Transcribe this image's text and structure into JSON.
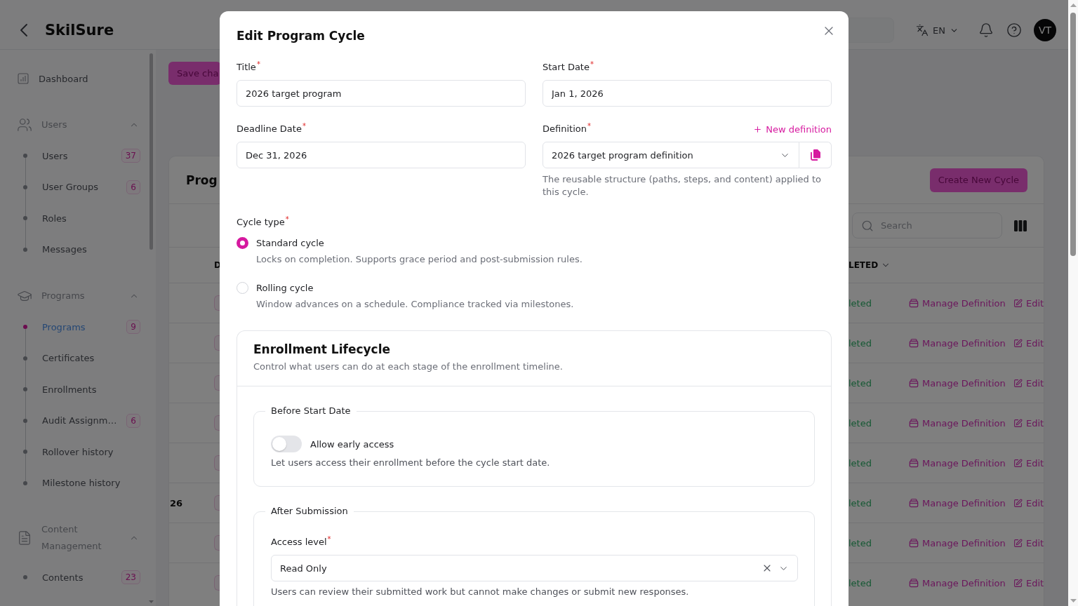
{
  "header": {
    "title": "SkilSure",
    "language": "EN",
    "avatar": "VT"
  },
  "sidebar": {
    "items": [
      {
        "kind": "link",
        "label": "Dashboard",
        "selected": false
      },
      {
        "kind": "group",
        "label": "Users",
        "expanded": true,
        "children": [
          {
            "label": "Users",
            "badge": "37",
            "selected": false
          },
          {
            "label": "User Groups",
            "badge": "6",
            "selected": false
          },
          {
            "label": "Roles",
            "selected": false
          },
          {
            "label": "Messages",
            "selected": false
          }
        ]
      },
      {
        "kind": "group",
        "label": "Programs",
        "expanded": true,
        "children": [
          {
            "label": "Programs",
            "badge": "9",
            "selected": true
          },
          {
            "label": "Certificates",
            "selected": false
          },
          {
            "label": "Enrollments",
            "selected": false
          },
          {
            "label": "Audit Assignm…",
            "badge": "6",
            "selected": false
          },
          {
            "label": "Rollover history",
            "selected": false
          },
          {
            "label": "Milestone history",
            "selected": false
          }
        ]
      },
      {
        "kind": "group",
        "label": "Content Management",
        "expanded": true,
        "children": [
          {
            "label": "Contents",
            "badge": "23",
            "selected": false
          }
        ]
      }
    ]
  },
  "main": {
    "save_button": "Save cha",
    "table_card": {
      "title": "Prog",
      "create_button": "Create New Cycle",
      "search": {
        "placeholder": "Search"
      },
      "columns": [
        "D",
        "LETED"
      ],
      "rows": [
        {
          "column_3": "leted",
          "actions": [
            "Manage Definition",
            "Edit"
          ]
        },
        {
          "column_3": "leted",
          "actions": [
            "Manage Definition",
            "Edit"
          ]
        },
        {
          "column_3": "leted",
          "actions": [
            "Manage Definition",
            "Edit"
          ]
        },
        {
          "column_3": "leted",
          "actions": [
            "Manage Definition",
            "Edit"
          ]
        },
        {
          "column_3": "leted",
          "actions": [
            "Manage Definition",
            "Edit"
          ]
        },
        {
          "column_1": "26",
          "column_3": "leted",
          "actions": [
            "Manage Definition",
            "Edit"
          ]
        },
        {
          "column_3": "leted",
          "actions": [
            "Manage Definition",
            "Edit"
          ]
        },
        {
          "column_3": "leted",
          "actions": [
            "Manage Definition",
            "Edit"
          ]
        }
      ]
    }
  },
  "dialog": {
    "title": "Edit Program Cycle",
    "fields": [
      {
        "kind": "text",
        "label": "Title$^{*}$",
        "value": "2026 target program"
      },
      {
        "kind": "date",
        "label": "Start Date$^{*}$",
        "value": "Jan 1, 2026"
      },
      {
        "kind": "date",
        "label": "Deadline Date$^{*}$",
        "value": "Dec 31, 2026"
      },
      {
        "kind": "select",
        "label": "Definition$^{*}$",
        "value": "2026 target program definition",
        "link": "New definition",
        "hint": "The reusable structure (paths, steps, and content) applied to this cycle."
      }
    ],
    "cycle_type": {
      "label": "Cycle type$^{*}$",
      "options": [
        {
          "label": "Standard cycle",
          "description": "Locks on completion. Supports grace period and post-submission rules.",
          "selected": true
        },
        {
          "label": "Rolling cycle",
          "description": "Window advances on a schedule. Compliance tracked via milestones.",
          "selected": false
        }
      ]
    },
    "lifecycle": {
      "title": "Enrollment Lifecycle",
      "subtitle": "Control what users can do at each stage of the enrollment timeline.",
      "groups": [
        {
          "kind": "toggle",
          "legend": "Before Start Date",
          "label": "Allow early access",
          "on": false,
          "description": "Let users access their enrollment before the cycle start date."
        },
        {
          "kind": "select",
          "legend": "After Submission",
          "label": "Access level$^{*}$",
          "value": "Read Only",
          "description": "Users can review their submitted work but cannot make changes or submit new responses."
        }
      ]
    }
  }
}
